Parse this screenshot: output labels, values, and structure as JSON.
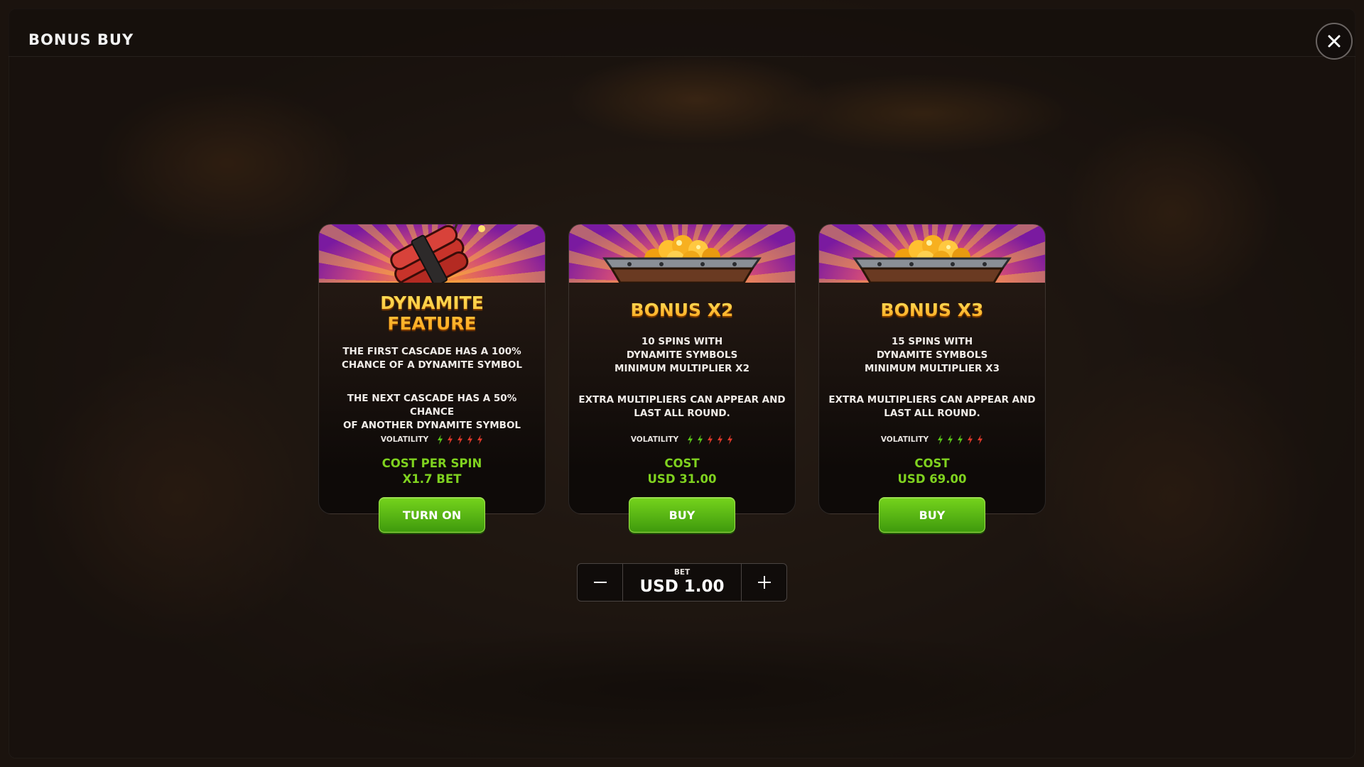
{
  "header": {
    "title": "BONUS BUY",
    "close_icon": "close-icon"
  },
  "cards": [
    {
      "title_line1": "DYNAMITE",
      "title_line2": "FEATURE",
      "desc1": "THE FIRST CASCADE HAS A 100%\nCHANCE OF A DYNAMITE SYMBOL",
      "desc2": "THE NEXT CASCADE HAS A 50% CHANCE\nOF ANOTHER DYNAMITE SYMBOL",
      "volatility_label": "VOLATILITY",
      "volatility_level": 1,
      "volatility_max": 5,
      "cost_line1": "COST PER SPIN",
      "cost_line2": "X1.7 BET",
      "button_label": "TURN ON",
      "image": "dynamite-icon"
    },
    {
      "title_line1": "BONUS X2",
      "desc1": "10 SPINS WITH\nDYNAMITE SYMBOLS\nMINIMUM MULTIPLIER X2",
      "desc2": "EXTRA MULTIPLIERS CAN APPEAR AND\nLAST ALL ROUND.",
      "volatility_label": "VOLATILITY",
      "volatility_level": 2,
      "volatility_max": 5,
      "cost_line1": "COST",
      "cost_line2": "USD 31.00",
      "button_label": "BUY",
      "image": "gold-minecart-icon"
    },
    {
      "title_line1": "BONUS X3",
      "desc1": "15 SPINS WITH\nDYNAMITE SYMBOLS\nMINIMUM MULTIPLIER X3",
      "desc2": "EXTRA MULTIPLIERS CAN APPEAR AND\nLAST ALL ROUND.",
      "volatility_label": "VOLATILITY",
      "volatility_level": 3,
      "volatility_max": 5,
      "cost_line1": "COST",
      "cost_line2": "USD 69.00",
      "button_label": "BUY",
      "image": "gold-minecart-icon"
    }
  ],
  "bet": {
    "label": "BET",
    "value": "USD 1.00",
    "minus_icon": "minus-icon",
    "plus_icon": "plus-icon"
  },
  "colors": {
    "accent_green": "#7fd21f",
    "button_green": "#4cb012",
    "title_gold": "#ffc12a",
    "bolt_green": "#5cc81a",
    "bolt_red": "#e0392a",
    "banner_purple": "#7a1aa0"
  }
}
